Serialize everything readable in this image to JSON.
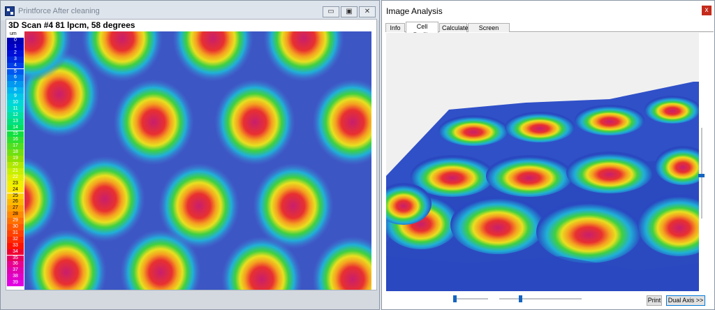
{
  "left_window": {
    "title": "Printforce After cleaning",
    "controls": {
      "minimize": "▭",
      "maximize": "▣",
      "close": "✕"
    },
    "scan_title": "3D Scan #4 81 lpcm, 58 degrees",
    "legend": {
      "unit": "um",
      "values": [
        "0",
        "1",
        "2",
        "3",
        "4",
        "5",
        "6",
        "7",
        "8",
        "9",
        "10",
        "11",
        "12",
        "13",
        "14",
        "15",
        "16",
        "17",
        "18",
        "19",
        "20",
        "21",
        "22",
        "23",
        "24",
        "25",
        "26",
        "27",
        "28",
        "29",
        "30",
        "31",
        "32",
        "33",
        "34",
        "35",
        "36",
        "37",
        "38",
        "39"
      ],
      "colors": [
        "#0000b4",
        "#0000c8",
        "#0010d8",
        "#0028e0",
        "#0040e8",
        "#0058f0",
        "#0078f0",
        "#0098f0",
        "#00b4f0",
        "#00c8e8",
        "#00d8d8",
        "#00e0c0",
        "#00e0a0",
        "#00e080",
        "#00e060",
        "#10e040",
        "#30e030",
        "#50e020",
        "#70e010",
        "#90e000",
        "#b0e800",
        "#c8f000",
        "#e0f000",
        "#f0f000",
        "#ffe800",
        "#ffd000",
        "#ffb800",
        "#ffa000",
        "#ff8800",
        "#ff7000",
        "#ff5800",
        "#ff4000",
        "#ff2800",
        "#ff1000",
        "#f00030",
        "#e80060",
        "#e80090",
        "#e000b0",
        "#e000c8",
        "#e000e0"
      ]
    }
  },
  "right_window": {
    "title": "Image Analysis",
    "close_glyph": "x",
    "tabs": [
      "Info",
      "Cell Profile",
      "Calculate",
      "Screen Count"
    ],
    "active_tab": "Cell Profile",
    "print_label": "Print",
    "dual_axis_label": "Dual Axis >>"
  }
}
